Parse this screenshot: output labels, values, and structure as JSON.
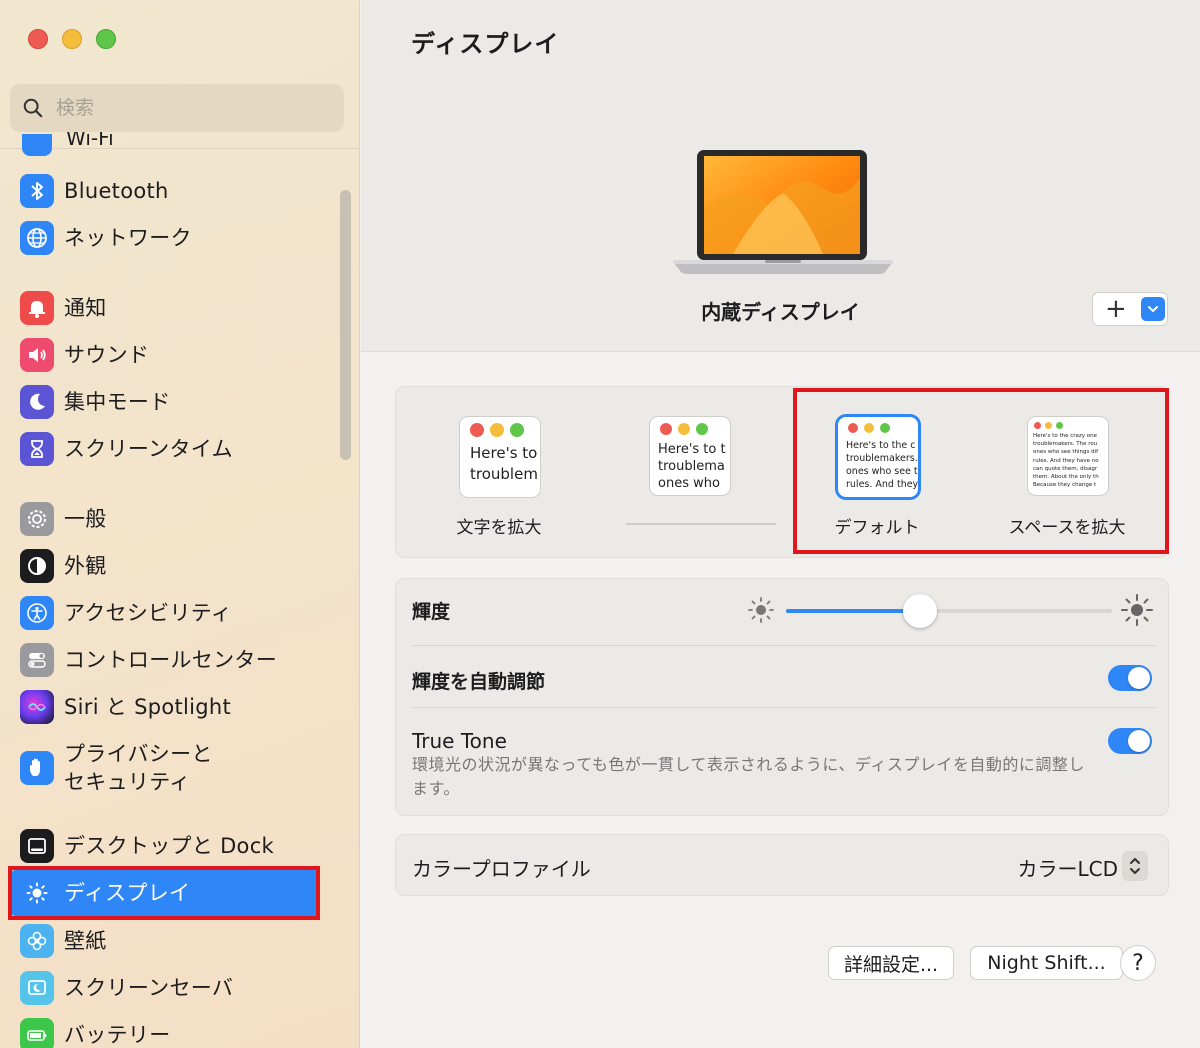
{
  "sidebar": {
    "search_placeholder": "検索",
    "partial_item": "Wi-Fi",
    "items": [
      {
        "label": "Bluetooth"
      },
      {
        "label": "ネットワーク"
      },
      {
        "label": "通知"
      },
      {
        "label": "サウンド"
      },
      {
        "label": "集中モード"
      },
      {
        "label": "スクリーンタイム"
      },
      {
        "label": "一般"
      },
      {
        "label": "外観"
      },
      {
        "label": "アクセシビリティ"
      },
      {
        "label": "コントロールセンター"
      },
      {
        "label": "Siri と Spotlight"
      },
      {
        "label_line1": "プライバシーと",
        "label_line2": "セキュリティ"
      },
      {
        "label": "デスクトップと Dock"
      },
      {
        "label": "ディスプレイ"
      },
      {
        "label": "壁紙"
      },
      {
        "label": "スクリーンセーバ"
      },
      {
        "label": "バッテリー"
      }
    ],
    "active_item": "ディスプレイ"
  },
  "main": {
    "title": "ディスプレイ",
    "display_name": "内蔵ディスプレイ",
    "add_symbol": "+",
    "resolution": {
      "options": [
        {
          "label": "文字を拡大",
          "preview": "Here's to\ntroublem"
        },
        {
          "label": "",
          "preview": "Here's to t\ntroublema\nones who"
        },
        {
          "label": "デフォルト",
          "preview": "Here's to the c\ntroublemakers.\nones who see t\nrules. And they"
        },
        {
          "label": "スペースを拡大",
          "preview": "Here's to the crazy one\ntroublemakers. The rou\nones who see things dif\nrules. And they have no\ncan quote them, disagr\nthem. About the only th\nBecause they change t"
        }
      ],
      "selected": "デフォルト"
    },
    "brightness_label": "輝度",
    "brightness_level": 0.41,
    "auto_brightness_label": "輝度を自動調節",
    "auto_brightness_on": true,
    "true_tone_label": "True Tone",
    "true_tone_on": true,
    "true_tone_desc": "環境光の状況が異なっても色が一貫して表示されるように、ディスプレイを自動的に調整します。",
    "color_profile_label": "カラープロファイル",
    "color_profile_value": "カラーLCD",
    "advanced_button": "詳細設定...",
    "night_shift_button": "Night Shift...",
    "help_button": "?"
  },
  "colors": {
    "accent": "#2f86f6",
    "highlight_box": "#e0161f"
  }
}
